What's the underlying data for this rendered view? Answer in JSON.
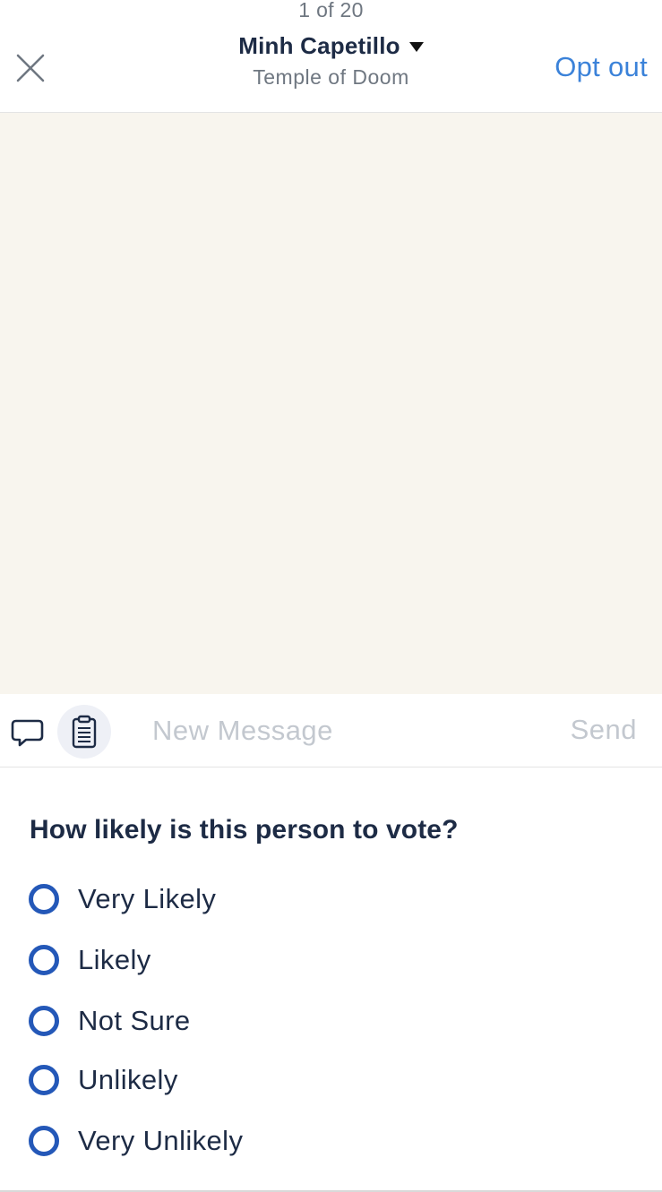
{
  "header": {
    "counter": "1 of 20",
    "contact_name": "Minh Capetillo",
    "contact_subtitle": "Temple of Doom",
    "opt_out_label": "Opt out",
    "close_icon": "close-icon",
    "dropdown_icon": "caret-down-icon"
  },
  "composer": {
    "placeholder": "New Message",
    "value": "",
    "send_label": "Send",
    "chat_icon": "speech-bubble-icon",
    "script_icon": "clipboard-icon"
  },
  "survey": {
    "question": "How likely is this person to vote?",
    "options": [
      {
        "label": "Very Likely",
        "selected": false
      },
      {
        "label": "Likely",
        "selected": false
      },
      {
        "label": "Not Sure",
        "selected": false
      },
      {
        "label": "Unlikely",
        "selected": false
      },
      {
        "label": "Very Unlikely",
        "selected": false
      }
    ]
  },
  "colors": {
    "accent": "#3b82d9",
    "radio": "#2458b8",
    "text_dark": "#1d2b45",
    "muted": "#6f7781",
    "conversation_bg": "#f8f5ee"
  }
}
